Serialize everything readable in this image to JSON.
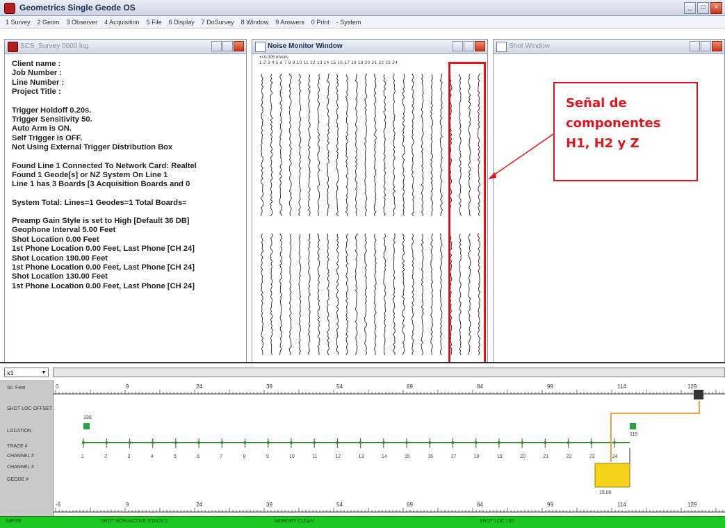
{
  "app": {
    "title": "Geometrics Single Geode OS",
    "menu": [
      "1 Survey",
      "2 Geom",
      "3 Observer",
      "4 Acquisition",
      "5 File",
      "6 Display",
      "7 DoSurvey",
      "8 Window",
      "9 Answers",
      "0 Print",
      "- System"
    ]
  },
  "log_panel": {
    "title": "SCS_Survey 0000 log",
    "lines": [
      "Client name  :",
      "Job Number  :",
      "Line Number  :",
      "Project Title  :",
      "",
      "Trigger Holdoff 0.20s.",
      "Trigger Sensitivity 50.",
      "Auto Arm is ON.",
      "Self Trigger is OFF.",
      "Not Using External Trigger Distribution Box",
      "",
      "Found Line 1 Connected To Network Card: Realtel",
      "Found 1 Geode[s] or NZ System On Line 1",
      "Line 1 has 3 Boards [3 Acquisition Boards and 0",
      "",
      "System Total: Lines=1  Geodes=1  Total Boards=",
      "",
      "Preamp Gain Style is set to High [Default 36 DB]",
      "Geophone Interval 5.00 Feet",
      "Shot Location 0.00 Feet",
      "1st Phone Location 0.00 Feet, Last Phone [CH 24]",
      "Shot Location 190.00 Feet",
      "1st Phone Location 0.00 Feet, Last Phone [CH 24]",
      "Shot Location 130.00 Feet",
      "1st Phone Location 0.00 Feet, Last Phone [CH 24]"
    ]
  },
  "noise_panel": {
    "title": "Noise Monitor Window",
    "scale_label": "+/-0.005 mVolts",
    "channels": [
      "1",
      "2",
      "3",
      "4",
      "5",
      "6",
      "7",
      "8",
      "9",
      "10",
      "11",
      "12",
      "13",
      "14",
      "15",
      "16",
      "17",
      "18",
      "19",
      "20",
      "21",
      "22",
      "23",
      "24"
    ]
  },
  "shot_panel": {
    "title": "Shot Window"
  },
  "annotation": {
    "lines": [
      "Señal de",
      "componentes",
      "H1, H2 y Z"
    ],
    "color": "#e0141c"
  },
  "layout_view": {
    "zoom_value": "x1",
    "row_labels": [
      "Sc. Feet",
      "SHOT LOC OFFSET",
      "LOCATION",
      "TRACE #",
      "CHANNEL #",
      "CHANNEL #",
      "GEODE #"
    ],
    "top_ruler_ticks": [
      "0",
      "9",
      "24",
      "39",
      "54",
      "69",
      "84",
      "99",
      "114",
      "129"
    ],
    "bottom_ruler_ticks": [
      "-6",
      "9",
      "24",
      "39",
      "54",
      "69",
      "84",
      "99",
      "114",
      "129"
    ],
    "trace_numbers": [
      "1",
      "2",
      "3",
      "4",
      "5",
      "6",
      "7",
      "8",
      "9",
      "10",
      "11",
      "12",
      "13",
      "14",
      "15",
      "16",
      "17",
      "18",
      "19",
      "20",
      "21",
      "22",
      "23",
      "24"
    ],
    "flag_left_label": "130",
    "flag_right_label": "115",
    "geode_label": "15.00",
    "line_color": "#3a8a3a",
    "cable_color": "#f0a040"
  },
  "status_bar": {
    "items": [
      "IMPER",
      "SHOT NOW/ACTIVE  STACK 0",
      "MEMORY CLEAN",
      "SHOT LOC 130"
    ]
  }
}
